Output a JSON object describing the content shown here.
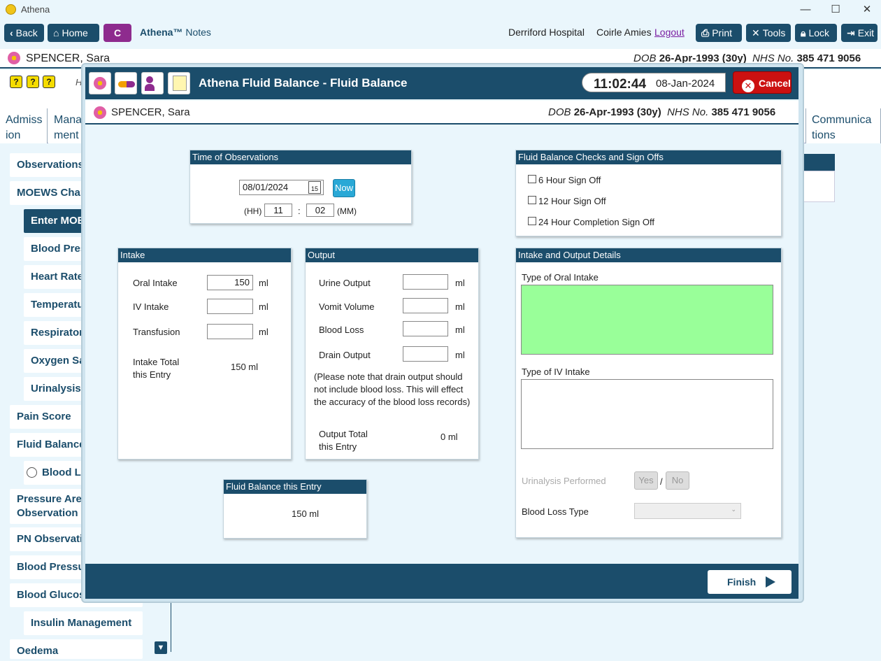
{
  "window": {
    "title": "Athena",
    "minimize": "—",
    "maximize": "☐",
    "close": "✕"
  },
  "toolbar": {
    "back": "Back",
    "home": "Home",
    "c_label": "C",
    "brand_name": "Athena™",
    "brand_sub": "Notes",
    "hospital": "Derriford Hospital",
    "user": "Coirle Amies",
    "logout": "Logout",
    "print": "Print",
    "tools": "Tools",
    "lock": "Lock",
    "exit": "Exit"
  },
  "patient": {
    "name": "SPENCER, Sara",
    "dob_label": "DOB",
    "dob": "26-Apr-1993 (30y)",
    "nhs_label": "NHS No.",
    "nhs": "385 471 9056"
  },
  "background": {
    "strip_text": "H",
    "tabs": [
      "Admiss ion",
      "Mana ment",
      "Communica tions"
    ],
    "sidebar": [
      {
        "label": "Observations",
        "level": 0
      },
      {
        "label": "MOEWS Chart",
        "level": 0
      },
      {
        "label": "Enter MOEWS",
        "level": 1,
        "active": true
      },
      {
        "label": "Blood Pressure",
        "level": 1
      },
      {
        "label": "Heart Rate",
        "level": 1
      },
      {
        "label": "Temperature",
        "level": 1
      },
      {
        "label": "Respiratory",
        "level": 1
      },
      {
        "label": "Oxygen Sat",
        "level": 1
      },
      {
        "label": "Urinalysis",
        "level": 1
      },
      {
        "label": "Pain Score",
        "level": 0
      },
      {
        "label": "Fluid Balance",
        "level": 0
      },
      {
        "label": "Blood Lo",
        "level": 1,
        "radio": true
      },
      {
        "label": "Pressure Areas Observation",
        "level": 0,
        "tall": true
      },
      {
        "label": "PN Observatio",
        "level": 0
      },
      {
        "label": "Blood Pressur",
        "level": 0
      },
      {
        "label": "Blood Glucose",
        "level": 0
      },
      {
        "label": "Insulin Management",
        "level": 1
      },
      {
        "label": "Oedema",
        "level": 0
      }
    ]
  },
  "modal": {
    "title": "Athena Fluid Balance - Fluid Balance",
    "time": "11:02:44",
    "date": "08-Jan-2024",
    "cancel": "Cancel",
    "finish": "Finish",
    "time_obs": {
      "header": "Time of Observations",
      "date_value": "08/01/2024",
      "cal_day": "15",
      "now": "Now",
      "hh_label": "(HH)",
      "hh": "11",
      "sep": ":",
      "mm": "02",
      "mm_label": "(MM)"
    },
    "checks": {
      "header": "Fluid Balance Checks and Sign Offs",
      "items": [
        "6 Hour Sign Off",
        "12 Hour Sign Off",
        "24 Hour Completion Sign Off"
      ]
    },
    "intake": {
      "header": "Intake",
      "oral_label": "Oral Intake",
      "oral_value": "150",
      "iv_label": "IV Intake",
      "iv_value": "",
      "transfusion_label": "Transfusion",
      "transfusion_value": "",
      "unit": "ml",
      "total_label": "Intake Total this Entry",
      "total_value": "150 ml"
    },
    "output": {
      "header": "Output",
      "urine_label": "Urine Output",
      "vomit_label": "Vomit Volume",
      "blood_label": "Blood Loss",
      "drain_label": "Drain Output",
      "unit": "ml",
      "note": "(Please note that drain output should not include blood loss. This will effect the accuracy of the blood loss records)",
      "total_label": "Output Total this Entry",
      "total_value": "0 ml"
    },
    "balance": {
      "header": "Fluid Balance this Entry",
      "value": "150 ml"
    },
    "details": {
      "header": "Intake and Output Details",
      "oral_type_label": "Type of Oral Intake",
      "iv_type_label": "Type of IV Intake",
      "urinalysis_label": "Urinalysis Performed",
      "yes": "Yes",
      "slash": "/",
      "no": "No",
      "blood_loss_type_label": "Blood Loss Type"
    }
  },
  "colors": {
    "primary": "#1b4d6b",
    "oral_field": "#99ff99",
    "cancel": "#cc1111",
    "now": "#29a8d6"
  }
}
